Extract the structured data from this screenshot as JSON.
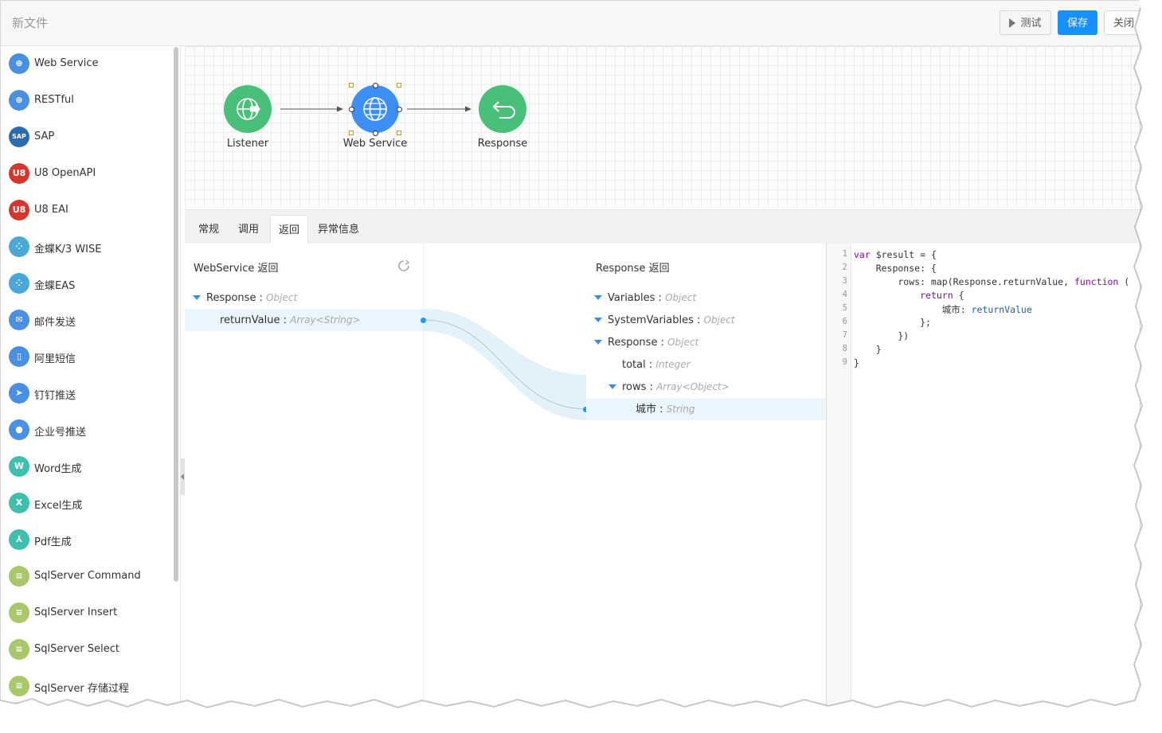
{
  "window": {
    "title": "新文件"
  },
  "toolbar": {
    "test_label": "测试",
    "save_label": "保存",
    "close_label": "关闭"
  },
  "sidebar": {
    "items": [
      {
        "label": "Web Service",
        "icon": "globe-icon",
        "color": "#4a90e2",
        "glyph": "⊕"
      },
      {
        "label": "RESTful",
        "icon": "rest-icon",
        "color": "#4a90e2",
        "glyph": "⊕"
      },
      {
        "label": "SAP",
        "icon": "sap-icon",
        "color": "#2b6cb0",
        "glyph": "SAP"
      },
      {
        "label": "U8 OpenAPI",
        "icon": "u8-icon",
        "color": "#d9362b",
        "glyph": "U8"
      },
      {
        "label": "U8 EAI",
        "icon": "u8-icon",
        "color": "#d9362b",
        "glyph": "U8"
      },
      {
        "label": "金蝶K/3 WISE",
        "icon": "kingdee-icon",
        "color": "#4aa8d8",
        "glyph": "⁘"
      },
      {
        "label": "金蝶EAS",
        "icon": "kingdee-icon",
        "color": "#4aa8d8",
        "glyph": "⁘"
      },
      {
        "label": "邮件发送",
        "icon": "mail-icon",
        "color": "#4a90e2",
        "glyph": "✉"
      },
      {
        "label": "阿里短信",
        "icon": "phone-icon",
        "color": "#4a90e2",
        "glyph": "▯"
      },
      {
        "label": "钉钉推送",
        "icon": "dingtalk-icon",
        "color": "#4a90e2",
        "glyph": "➤"
      },
      {
        "label": "企业号推送",
        "icon": "chat-icon",
        "color": "#4a90e2",
        "glyph": "●"
      },
      {
        "label": "Word生成",
        "icon": "word-icon",
        "color": "#3fbfae",
        "glyph": "W"
      },
      {
        "label": "Excel生成",
        "icon": "excel-icon",
        "color": "#3fbfae",
        "glyph": "X"
      },
      {
        "label": "Pdf生成",
        "icon": "pdf-icon",
        "color": "#3fbfae",
        "glyph": "⅄"
      },
      {
        "label": "SqlServer Command",
        "icon": "database-icon",
        "color": "#a8c86a",
        "glyph": "≡"
      },
      {
        "label": "SqlServer Insert",
        "icon": "database-icon",
        "color": "#a8c86a",
        "glyph": "≡"
      },
      {
        "label": "SqlServer Select",
        "icon": "database-icon",
        "color": "#a8c86a",
        "glyph": "≡"
      },
      {
        "label": "SqlServer 存储过程",
        "icon": "database-icon",
        "color": "#a8c86a",
        "glyph": "≡"
      }
    ]
  },
  "flow": {
    "nodes": [
      {
        "label": "Listener",
        "icon": "globe-arrow-icon",
        "color": "#49c07a"
      },
      {
        "label": "Web Service",
        "icon": "globe-icon",
        "color": "#3d8ef5"
      },
      {
        "label": "Response",
        "icon": "return-icon",
        "color": "#49c07a"
      }
    ]
  },
  "tabs": [
    {
      "label": "常规",
      "active": false
    },
    {
      "label": "调用",
      "active": false
    },
    {
      "label": "返回",
      "active": true
    },
    {
      "label": "异常信息",
      "active": false
    }
  ],
  "mapping": {
    "left_title": "WebService 返回",
    "right_title": "Response 返回",
    "left_tree": [
      {
        "name": "Response",
        "type": "Object"
      },
      {
        "name": "returnValue",
        "type": "Array<String>"
      }
    ],
    "right_tree": [
      {
        "name": "Variables",
        "type": "Object"
      },
      {
        "name": "SystemVariables",
        "type": "Object"
      },
      {
        "name": "Response",
        "type": "Object"
      },
      {
        "name": "total",
        "type": "Integer"
      },
      {
        "name": "rows",
        "type": "Array<Object>"
      },
      {
        "name": "城市",
        "type": "String"
      }
    ]
  },
  "editor": {
    "line_numbers": [
      "1",
      "2",
      "3",
      "4",
      "5",
      "6",
      "7",
      "8",
      "9"
    ],
    "lines": [
      "var $result = {",
      "    Response: {",
      "        rows: map(Response.returnValue, function (",
      "            return {",
      "                城市: returnValue",
      "            };",
      "        })",
      "    }",
      "}"
    ]
  },
  "colors": {
    "accent": "#1890ff",
    "node_green": "#49c07a",
    "node_blue": "#3d8ef5",
    "mapping_link": "#d9ecfa"
  }
}
